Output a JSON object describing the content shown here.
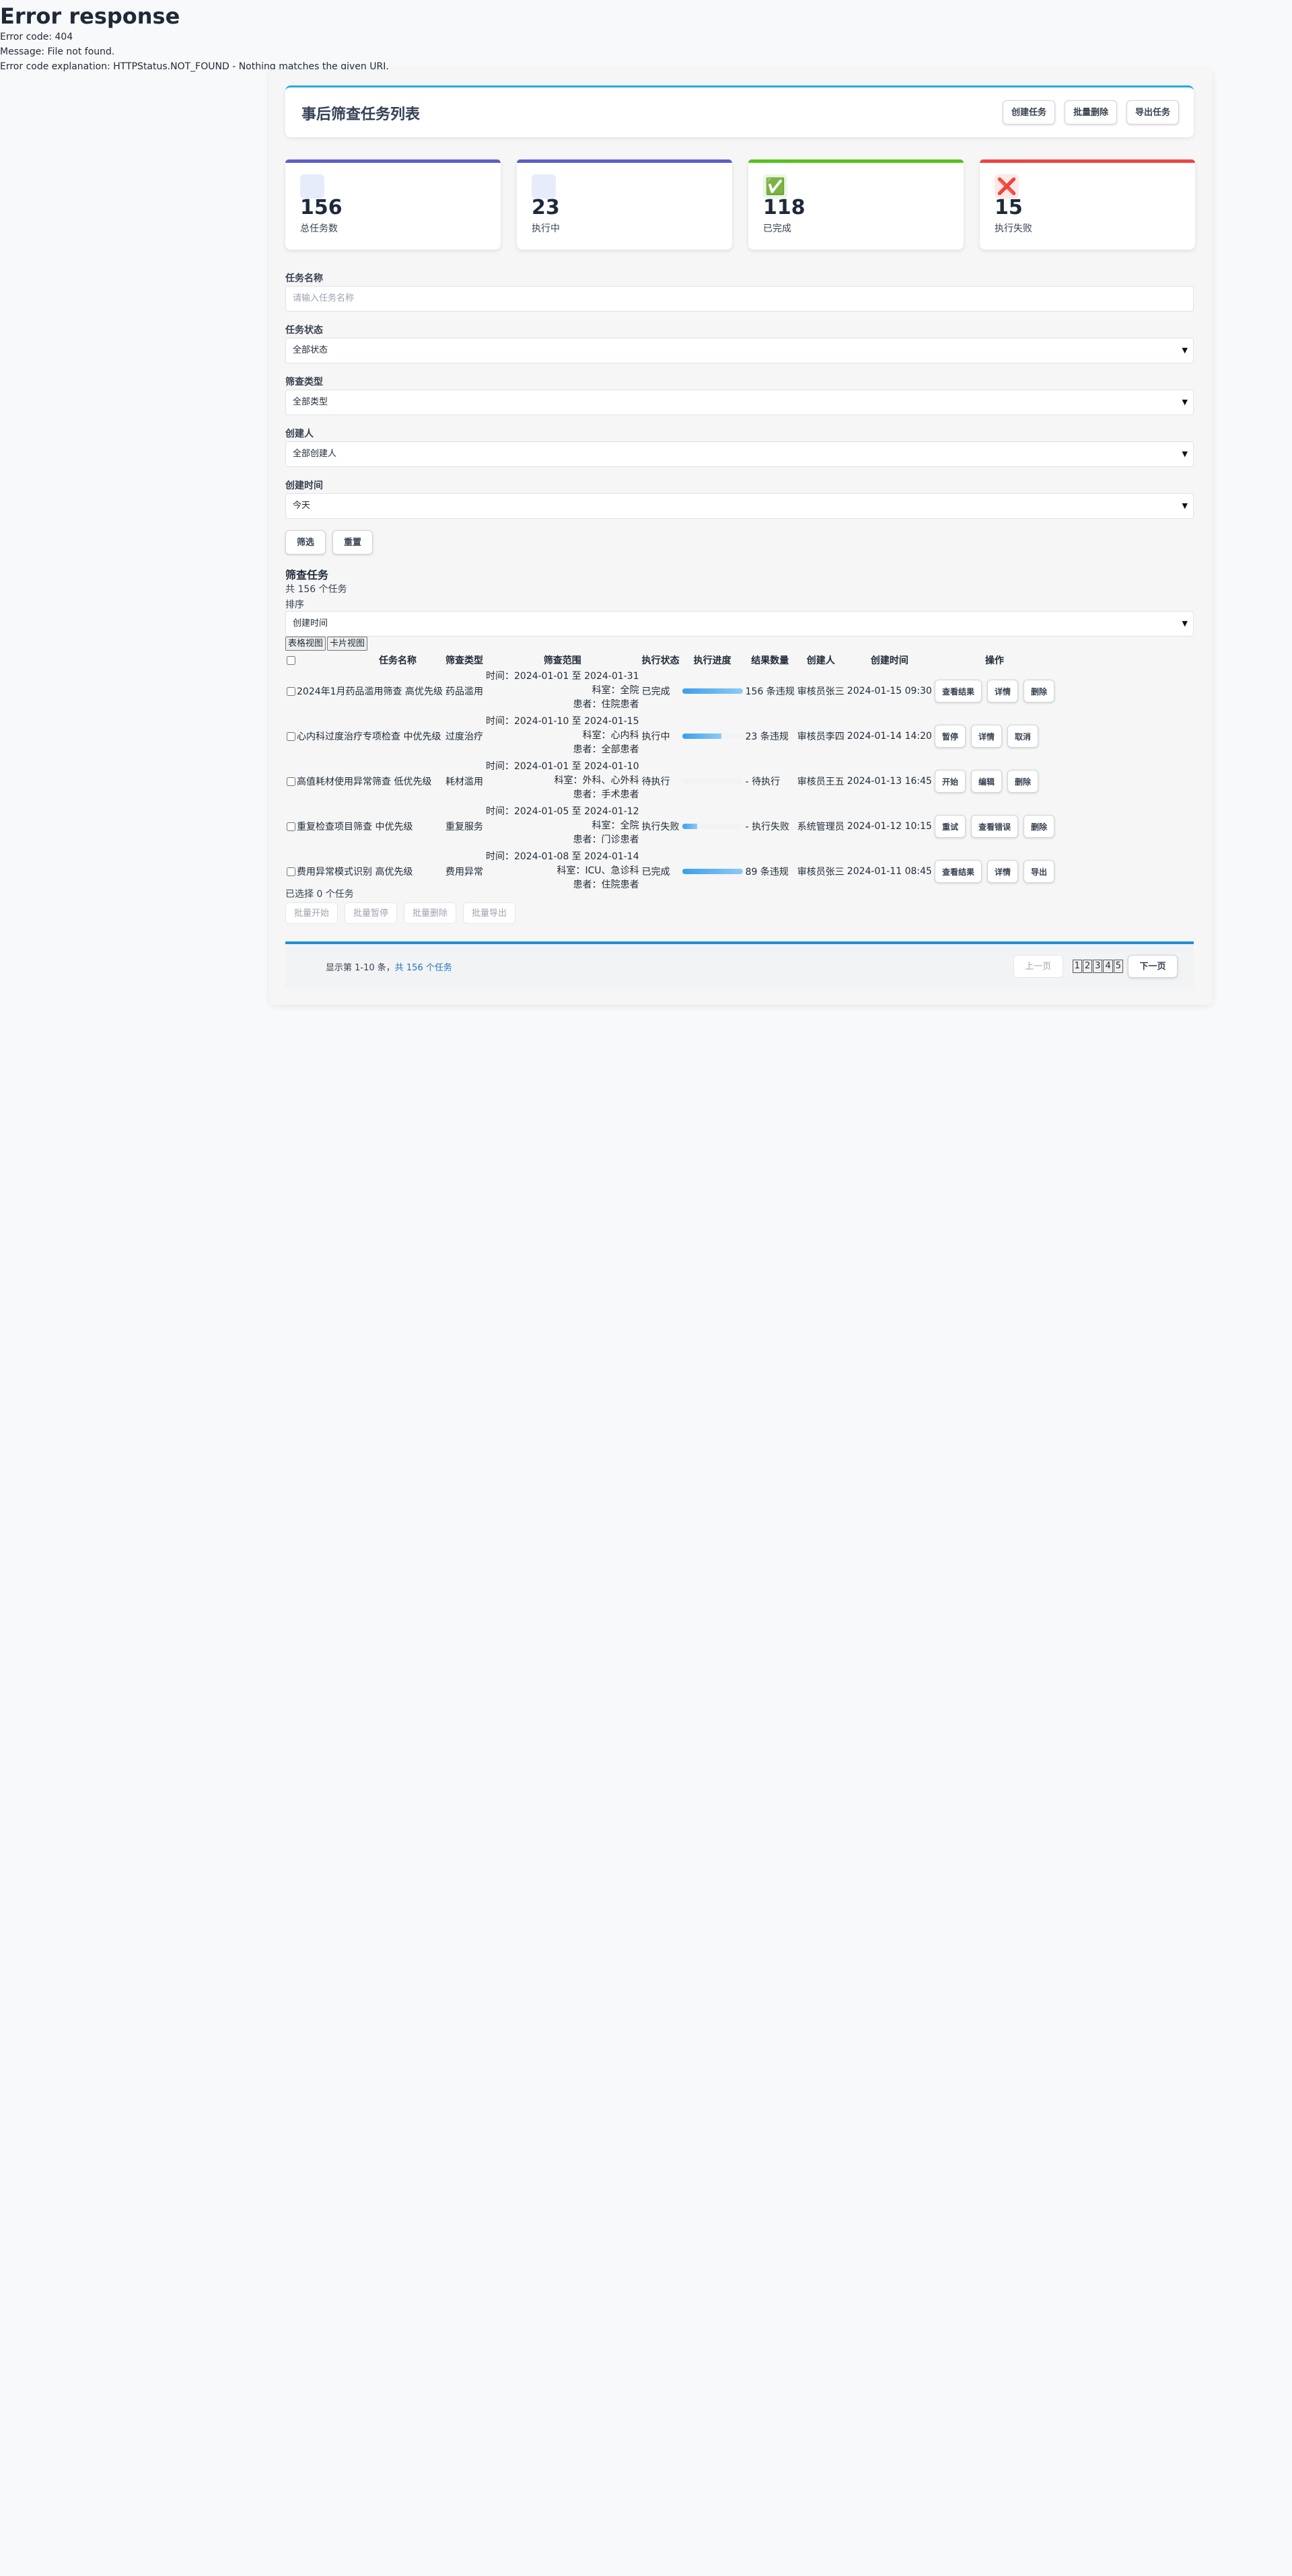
{
  "error": {
    "heading": "Error response",
    "code": "Error code: 404",
    "message": "Message: File not found.",
    "explanation": "Error code explanation: HTTPStatus.NOT_FOUND - Nothing matches the given URI."
  },
  "header": {
    "title": "事后筛查任务列表",
    "create_label": "创建任务",
    "batch_delete_label": "批量删除",
    "export_label": "导出任务"
  },
  "stats": [
    {
      "value": "156",
      "label": "总任务数",
      "color": "#5b5fc7"
    },
    {
      "value": "23",
      "label": "执行中",
      "color": "#5b5fc7"
    },
    {
      "value": "118",
      "label": "已完成",
      "color": "#52c41a",
      "icon": "✅"
    },
    {
      "value": "15",
      "label": "执行失败",
      "color": "#ef4444",
      "icon": "❌"
    }
  ],
  "filters": {
    "task_name_label": "任务名称",
    "task_name_placeholder": "请输入任务名称",
    "status_label": "任务状态",
    "status_value": "全部状态",
    "type_label": "筛查类型",
    "type_value": "全部类型",
    "creator_label": "创建人",
    "creator_value": "全部创建人",
    "time_label": "创建时间",
    "time_value": "今天",
    "filter_label": "筛选",
    "reset_label": "重置"
  },
  "section": {
    "title": "筛查任务",
    "count": "共 156 个任务",
    "sort_label": "排序",
    "sort_value": "创建时间",
    "table_view_label": "表格视图",
    "card_view_label": "卡片视图"
  },
  "table": {
    "headers": [
      "任务名称",
      "筛查类型",
      "筛查范围",
      "执行状态",
      "执行进度",
      "结果数量",
      "创建人",
      "创建时间",
      "操作"
    ],
    "rows": [
      {
        "name": "2024年1月药品滥用筛查",
        "priority": "高优先级",
        "type": "药品滥用",
        "time": "时间：2024-01-01 至 2024-01-31",
        "dept": "科室：全院",
        "patient": "患者：住院患者",
        "status": "已完成",
        "progress": 1.0,
        "result": "156 条违规",
        "creator": "审核员张三",
        "created": "2024-01-15 09:30",
        "ops": [
          "查看结果",
          "详情",
          "删除"
        ]
      },
      {
        "name": "心内科过度治疗专项检查",
        "priority": "中优先级",
        "type": "过度治疗",
        "time": "时间：2024-01-10 至 2024-01-15",
        "dept": "科室：心内科",
        "patient": "患者：全部患者",
        "status": "执行中",
        "progress": 0.65,
        "result": "23 条违规",
        "creator": "审核员李四",
        "created": "2024-01-14 14:20",
        "ops": [
          "暂停",
          "详情",
          "取消"
        ]
      },
      {
        "name": "高值耗材使用异常筛查",
        "priority": "低优先级",
        "type": "耗材滥用",
        "time": "时间：2024-01-01 至 2024-01-10",
        "dept": "科室：外科、心外科",
        "patient": "患者：手术患者",
        "status": "待执行",
        "progress": 0.0,
        "result": "- 待执行",
        "creator": "审核员王五",
        "created": "2024-01-13 16:45",
        "ops": [
          "开始",
          "编辑",
          "删除"
        ]
      },
      {
        "name": "重复检查项目筛查",
        "priority": "中优先级",
        "type": "重复服务",
        "time": "时间：2024-01-05 至 2024-01-12",
        "dept": "科室：全院",
        "patient": "患者：门诊患者",
        "status": "执行失败",
        "progress": 0.25,
        "result": "- 执行失败",
        "creator": "系统管理员",
        "created": "2024-01-12 10:15",
        "ops": [
          "重试",
          "查看错误",
          "删除"
        ]
      },
      {
        "name": "费用异常模式识别",
        "priority": "高优先级",
        "type": "费用异常",
        "time": "时间：2024-01-08 至 2024-01-14",
        "dept": "科室：ICU、急诊科",
        "patient": "患者：住院患者",
        "status": "已完成",
        "progress": 1.0,
        "result": "89 条违规",
        "creator": "审核员张三",
        "created": "2024-01-11 08:45",
        "ops": [
          "查看结果",
          "详情",
          "导出"
        ]
      }
    ]
  },
  "batch": {
    "selected": "已选择 0 个任务",
    "start_label": "批量开始",
    "pause_label": "批量暂停",
    "delete_label": "批量删除",
    "export_label": "批量导出"
  },
  "pagination": {
    "info_prefix": "显示第 1-10 条，",
    "info_total": "共 156 个任务",
    "prev_label": "上一页",
    "pages": [
      "1",
      "2",
      "3",
      "4",
      "5"
    ],
    "next_label": "下一页"
  }
}
